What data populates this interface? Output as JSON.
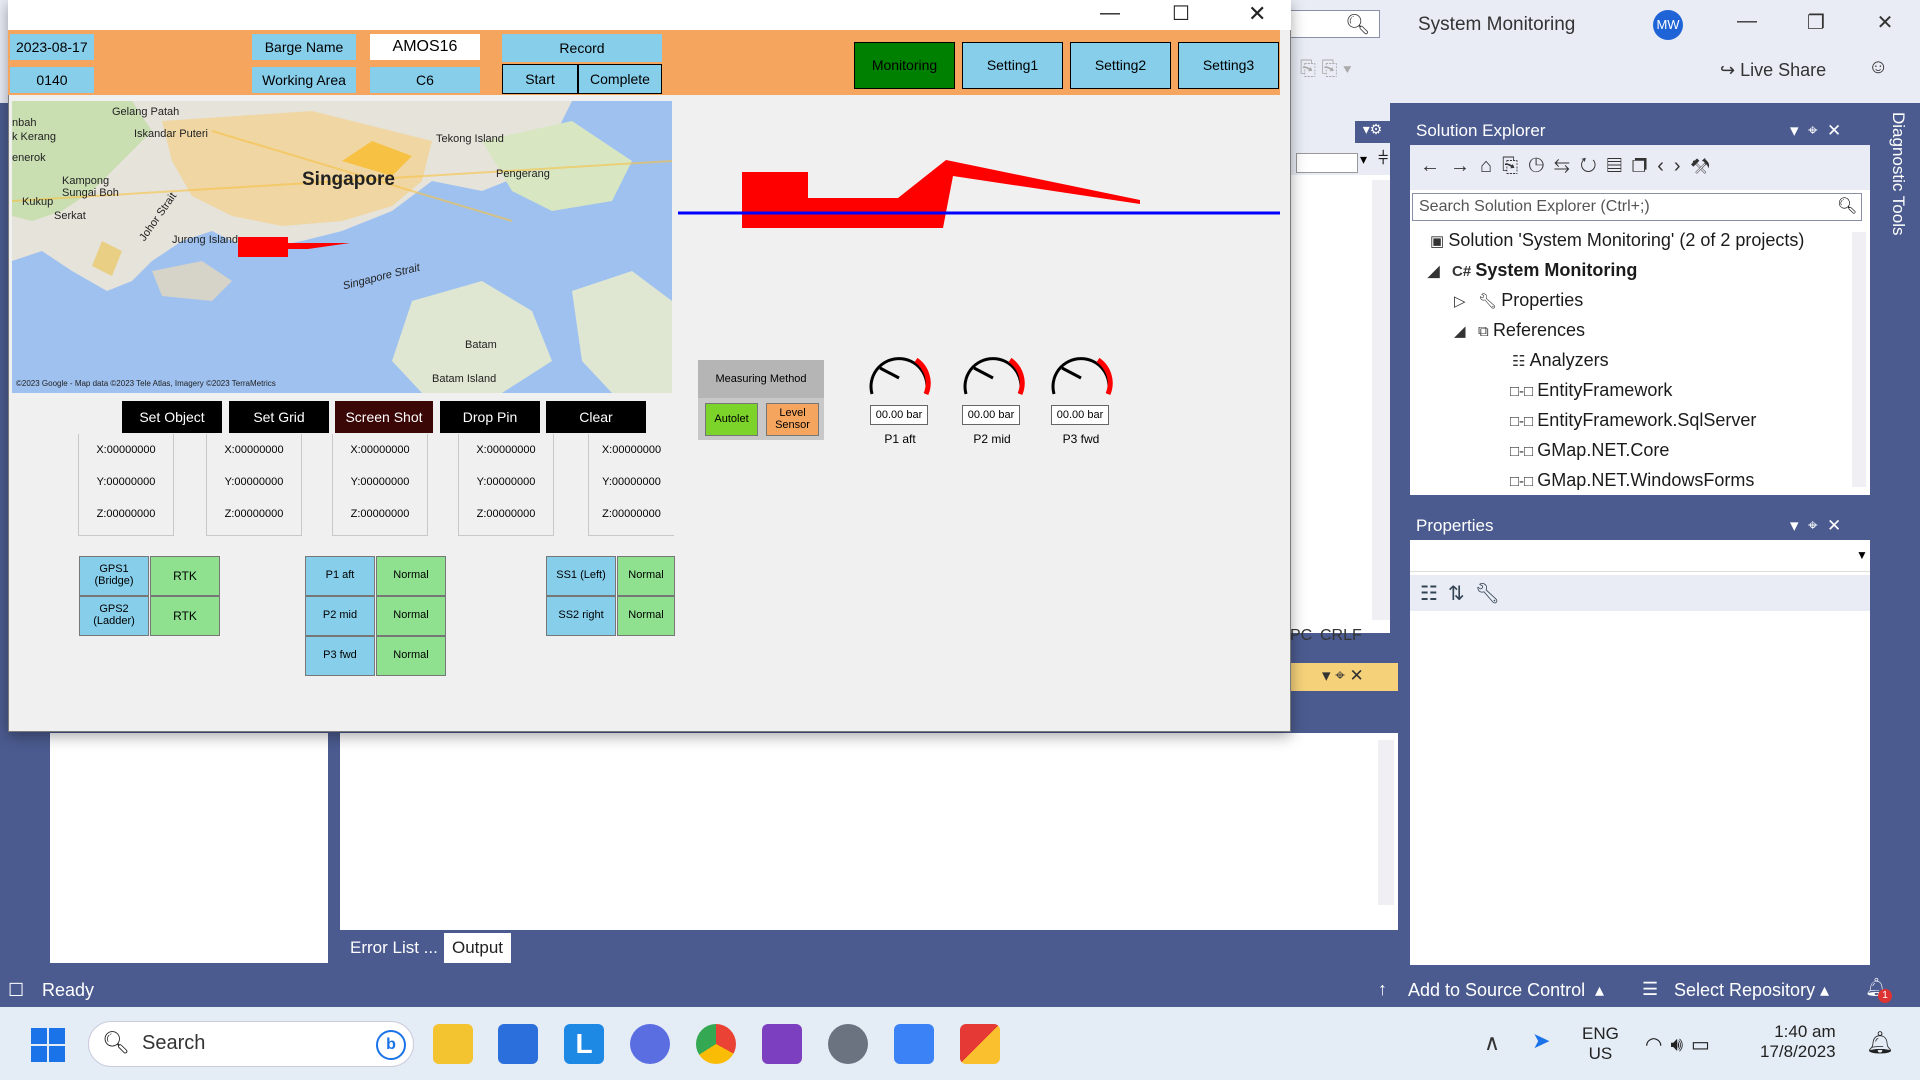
{
  "vs": {
    "title": "System Monitoring",
    "avatar": "MW",
    "live_share": "Live Share",
    "crlf": "CRLF",
    "solution_explorer": {
      "title": "Solution Explorer",
      "search_placeholder": "Search Solution Explorer (Ctrl+;)",
      "items": [
        {
          "label": "Solution 'System Monitoring' (2 of 2 projects)",
          "icon": "solution-icon"
        },
        {
          "label": "System Monitoring",
          "icon": "csharp-project-icon"
        },
        {
          "label": "Properties",
          "icon": "wrench-icon"
        },
        {
          "label": "References",
          "icon": "references-icon"
        },
        {
          "label": "Analyzers",
          "icon": "analyzer-icon"
        },
        {
          "label": "EntityFramework",
          "icon": "reference-icon"
        },
        {
          "label": "EntityFramework.SqlServer",
          "icon": "reference-icon"
        },
        {
          "label": "GMap.NET.Core",
          "icon": "reference-icon"
        },
        {
          "label": "GMap.NET.WindowsForms",
          "icon": "reference-icon"
        }
      ]
    },
    "properties": {
      "title": "Properties"
    },
    "diagnostic_tools": "Diagnostic Tools",
    "output_tabs": [
      "Error List ...",
      "Output"
    ],
    "status": {
      "ready": "Ready",
      "source_control": "Add to Source Control",
      "repository": "Select Repository",
      "notifications": "1"
    }
  },
  "taskbar": {
    "search_label": "Search",
    "language": "ENG",
    "region": "US",
    "time": "1:40 am",
    "date": "17/8/2023"
  },
  "app": {
    "date": "2023-08-17",
    "id_code": "0140",
    "barge_name_label": "Barge Name",
    "barge_name_value": "AMOS16",
    "working_area_label": "Working Area",
    "working_area_value": "C6",
    "record_label": "Record",
    "start_label": "Start",
    "complete_label": "Complete",
    "tabs": [
      "Monitoring",
      "Setting1",
      "Setting2",
      "Setting3"
    ],
    "map": {
      "labels": [
        "Gelang Patah",
        "Iskandar Puteri",
        "Singapore",
        "Tekong Island",
        "Pengerang",
        "Kampong Sungai Boh",
        "Kukup",
        "Serkat",
        "Johor Strait",
        "Jurong Island",
        "Singapore Strait",
        "Batam",
        "Batam Island",
        "nbah",
        "k Kerang",
        "enerok"
      ],
      "attribution": "©2023 Google - Map data ©2023 Tele Atlas, Imagery ©2023 TerraMetrics"
    },
    "map_buttons": [
      "Set Object",
      "Set Grid",
      "Screen Shot",
      "Drop Pin",
      "Clear"
    ],
    "coords": [
      {
        "x": "X:00000000",
        "y": "Y:00000000",
        "z": "Z:00000000"
      },
      {
        "x": "X:00000000",
        "y": "Y:00000000",
        "z": "Z:00000000"
      },
      {
        "x": "X:00000000",
        "y": "Y:00000000",
        "z": "Z:00000000"
      },
      {
        "x": "X:00000000",
        "y": "Y:00000000",
        "z": "Z:00000000"
      },
      {
        "x": "X:00000000",
        "y": "Y:00000000",
        "z": "Z:00000000"
      }
    ],
    "gps": [
      {
        "name": "GPS1\n(Bridge)",
        "status": "RTK"
      },
      {
        "name": "GPS2\n(Ladder)",
        "status": "RTK"
      }
    ],
    "pressure": [
      {
        "name": "P1 aft",
        "status": "Normal"
      },
      {
        "name": "P2 mid",
        "status": "Normal"
      },
      {
        "name": "P3 fwd",
        "status": "Normal"
      }
    ],
    "ss": [
      {
        "name": "SS1 (Left)",
        "status": "Normal"
      },
      {
        "name": "SS2 right",
        "status": "Normal"
      }
    ],
    "measuring_method": {
      "title": "Measuring Method",
      "autolet": "Autolet",
      "level_sensor": "Level\nSensor"
    },
    "gauges": [
      {
        "value": "00.00 bar",
        "label": "P1 aft"
      },
      {
        "value": "00.00 bar",
        "label": "P2 mid"
      },
      {
        "value": "00.00 bar",
        "label": "P3 fwd"
      }
    ]
  },
  "colors": {
    "orange_band": "#f6a55f",
    "sky_blue": "#87ceeb",
    "green_status": "#8fe08f",
    "active_tab": "#008000",
    "barge_red": "#ff0000",
    "waterline_blue": "#0000ff",
    "vs_blue": "#4b5b8f"
  }
}
